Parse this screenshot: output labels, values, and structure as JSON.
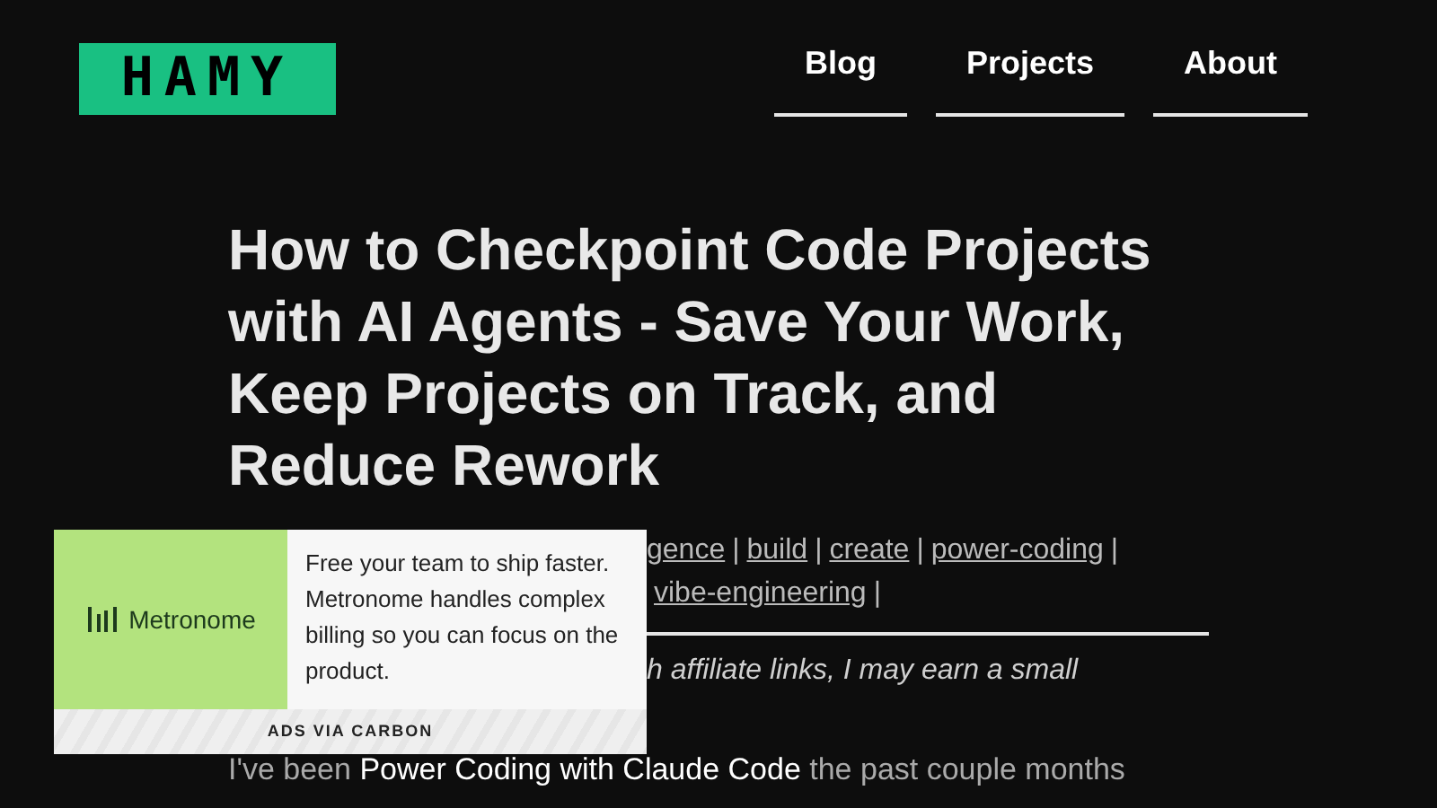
{
  "logo": "HAMY",
  "nav": [
    {
      "label": "Blog"
    },
    {
      "label": "Projects"
    },
    {
      "label": "About"
    }
  ],
  "article": {
    "title": "How to Checkpoint Code Projects with AI Agents - Save Your Work, Keep Projects on Track, and Reduce Rework",
    "tag_lines": [
      [
        "gence",
        "build",
        "create",
        "power-coding"
      ],
      [
        "vibe-engineering"
      ]
    ],
    "separator": "|",
    "disclosure": "h affiliate links, I may earn a small",
    "body_intro": "I've been ",
    "body_link": "Power Coding with Claude Code",
    "body_rest": " the past couple months"
  },
  "ad": {
    "brand": "Metronome",
    "text": "Free your team to ship faster. Metronome handles complex billing so you can focus on the product.",
    "footer": "ADS VIA CARBON"
  }
}
